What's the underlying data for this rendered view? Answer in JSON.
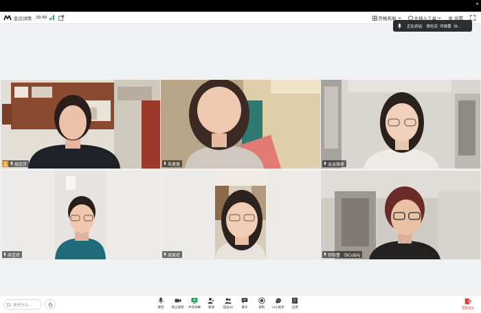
{
  "titlebar": {
    "meeting_details": "会议详情",
    "timer": "39:48",
    "layout": "宫格布局",
    "host_tools": "主持人工具",
    "settings": "设置"
  },
  "speaking": {
    "label": "正在讲话:",
    "names": "胡志芬; 邓晓蕾（B..."
  },
  "participants": [
    {
      "name": "胡志芬",
      "host": true,
      "active": true
    },
    {
      "name": "朱斐斐",
      "host": false,
      "active": false
    },
    {
      "name": "淡淡微笑",
      "host": false,
      "active": false
    },
    {
      "name": "吴佳欢",
      "host": false,
      "active": false
    },
    {
      "name": "吴家欢",
      "host": false,
      "active": false
    },
    {
      "name": "邓晓蕾 （BCoBA)",
      "host": false,
      "active": false
    }
  ],
  "toolbar": {
    "chat_placeholder": "说点什么...",
    "tools": [
      {
        "icon": "mic-icon",
        "label": "静音"
      },
      {
        "icon": "video-icon",
        "label": "停止视频"
      },
      {
        "icon": "share-screen-icon",
        "label": "共享屏幕"
      },
      {
        "icon": "invite-icon",
        "label": "邀请"
      },
      {
        "icon": "members-icon",
        "label": "成员(6)"
      },
      {
        "icon": "chat-icon",
        "label": "聊天"
      },
      {
        "icon": "record-icon",
        "label": "录制"
      },
      {
        "icon": "ai-icon",
        "label": "AI小助手"
      },
      {
        "icon": "apps-icon",
        "label": "应用"
      }
    ],
    "leave": "结束会议"
  },
  "colors": {
    "active_border": "#3ed08a",
    "host_badge": "#f39a1c",
    "leave_red": "#e0393e",
    "signal_green": "#27b15b"
  }
}
